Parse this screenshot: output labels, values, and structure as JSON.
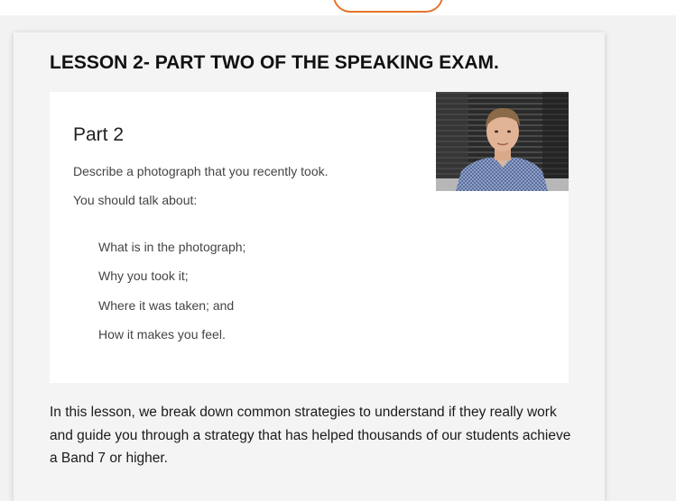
{
  "lesson": {
    "title": "LESSON 2- PART TWO OF THE SPEAKING EXAM."
  },
  "slide": {
    "heading": "Part 2",
    "prompt": "Describe a photograph that you recently took.",
    "instruction": "You should talk about:",
    "points": [
      "What is in the photograph;",
      "Why you took it;",
      "Where it was taken; and",
      "How it makes you feel."
    ]
  },
  "description": {
    "paragraph": "In this lesson, we break down common strategies to understand if they really work and guide you through a strategy that has helped thousands of our students achieve a Band 7 or higher."
  },
  "colors": {
    "accent": "#e8742c",
    "page_background": "#f2f2f2",
    "card_background": "#f4f4f4"
  }
}
